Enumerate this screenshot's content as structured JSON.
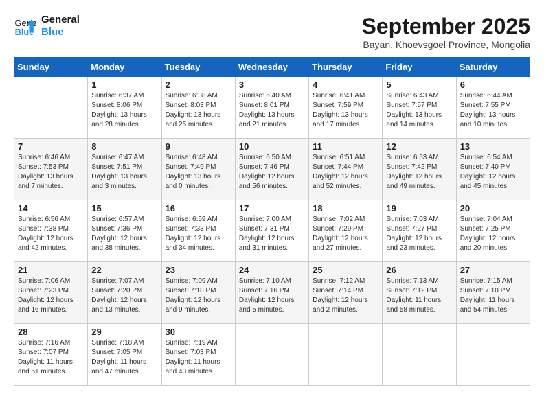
{
  "header": {
    "logo_line1": "General",
    "logo_line2": "Blue",
    "month": "September 2025",
    "location": "Bayan, Khoevsgoel Province, Mongolia"
  },
  "days_of_week": [
    "Sunday",
    "Monday",
    "Tuesday",
    "Wednesday",
    "Thursday",
    "Friday",
    "Saturday"
  ],
  "weeks": [
    [
      {
        "day": "",
        "content": ""
      },
      {
        "day": "1",
        "content": "Sunrise: 6:37 AM\nSunset: 8:06 PM\nDaylight: 13 hours\nand 28 minutes."
      },
      {
        "day": "2",
        "content": "Sunrise: 6:38 AM\nSunset: 8:03 PM\nDaylight: 13 hours\nand 25 minutes."
      },
      {
        "day": "3",
        "content": "Sunrise: 6:40 AM\nSunset: 8:01 PM\nDaylight: 13 hours\nand 21 minutes."
      },
      {
        "day": "4",
        "content": "Sunrise: 6:41 AM\nSunset: 7:59 PM\nDaylight: 13 hours\nand 17 minutes."
      },
      {
        "day": "5",
        "content": "Sunrise: 6:43 AM\nSunset: 7:57 PM\nDaylight: 13 hours\nand 14 minutes."
      },
      {
        "day": "6",
        "content": "Sunrise: 6:44 AM\nSunset: 7:55 PM\nDaylight: 13 hours\nand 10 minutes."
      }
    ],
    [
      {
        "day": "7",
        "content": "Sunrise: 6:46 AM\nSunset: 7:53 PM\nDaylight: 13 hours\nand 7 minutes."
      },
      {
        "day": "8",
        "content": "Sunrise: 6:47 AM\nSunset: 7:51 PM\nDaylight: 13 hours\nand 3 minutes."
      },
      {
        "day": "9",
        "content": "Sunrise: 6:48 AM\nSunset: 7:49 PM\nDaylight: 13 hours\nand 0 minutes."
      },
      {
        "day": "10",
        "content": "Sunrise: 6:50 AM\nSunset: 7:46 PM\nDaylight: 12 hours\nand 56 minutes."
      },
      {
        "day": "11",
        "content": "Sunrise: 6:51 AM\nSunset: 7:44 PM\nDaylight: 12 hours\nand 52 minutes."
      },
      {
        "day": "12",
        "content": "Sunrise: 6:53 AM\nSunset: 7:42 PM\nDaylight: 12 hours\nand 49 minutes."
      },
      {
        "day": "13",
        "content": "Sunrise: 6:54 AM\nSunset: 7:40 PM\nDaylight: 12 hours\nand 45 minutes."
      }
    ],
    [
      {
        "day": "14",
        "content": "Sunrise: 6:56 AM\nSunset: 7:38 PM\nDaylight: 12 hours\nand 42 minutes."
      },
      {
        "day": "15",
        "content": "Sunrise: 6:57 AM\nSunset: 7:36 PM\nDaylight: 12 hours\nand 38 minutes."
      },
      {
        "day": "16",
        "content": "Sunrise: 6:59 AM\nSunset: 7:33 PM\nDaylight: 12 hours\nand 34 minutes."
      },
      {
        "day": "17",
        "content": "Sunrise: 7:00 AM\nSunset: 7:31 PM\nDaylight: 12 hours\nand 31 minutes."
      },
      {
        "day": "18",
        "content": "Sunrise: 7:02 AM\nSunset: 7:29 PM\nDaylight: 12 hours\nand 27 minutes."
      },
      {
        "day": "19",
        "content": "Sunrise: 7:03 AM\nSunset: 7:27 PM\nDaylight: 12 hours\nand 23 minutes."
      },
      {
        "day": "20",
        "content": "Sunrise: 7:04 AM\nSunset: 7:25 PM\nDaylight: 12 hours\nand 20 minutes."
      }
    ],
    [
      {
        "day": "21",
        "content": "Sunrise: 7:06 AM\nSunset: 7:23 PM\nDaylight: 12 hours\nand 16 minutes."
      },
      {
        "day": "22",
        "content": "Sunrise: 7:07 AM\nSunset: 7:20 PM\nDaylight: 12 hours\nand 13 minutes."
      },
      {
        "day": "23",
        "content": "Sunrise: 7:09 AM\nSunset: 7:18 PM\nDaylight: 12 hours\nand 9 minutes."
      },
      {
        "day": "24",
        "content": "Sunrise: 7:10 AM\nSunset: 7:16 PM\nDaylight: 12 hours\nand 5 minutes."
      },
      {
        "day": "25",
        "content": "Sunrise: 7:12 AM\nSunset: 7:14 PM\nDaylight: 12 hours\nand 2 minutes."
      },
      {
        "day": "26",
        "content": "Sunrise: 7:13 AM\nSunset: 7:12 PM\nDaylight: 11 hours\nand 58 minutes."
      },
      {
        "day": "27",
        "content": "Sunrise: 7:15 AM\nSunset: 7:10 PM\nDaylight: 11 hours\nand 54 minutes."
      }
    ],
    [
      {
        "day": "28",
        "content": "Sunrise: 7:16 AM\nSunset: 7:07 PM\nDaylight: 11 hours\nand 51 minutes."
      },
      {
        "day": "29",
        "content": "Sunrise: 7:18 AM\nSunset: 7:05 PM\nDaylight: 11 hours\nand 47 minutes."
      },
      {
        "day": "30",
        "content": "Sunrise: 7:19 AM\nSunset: 7:03 PM\nDaylight: 11 hours\nand 43 minutes."
      },
      {
        "day": "",
        "content": ""
      },
      {
        "day": "",
        "content": ""
      },
      {
        "day": "",
        "content": ""
      },
      {
        "day": "",
        "content": ""
      }
    ]
  ]
}
